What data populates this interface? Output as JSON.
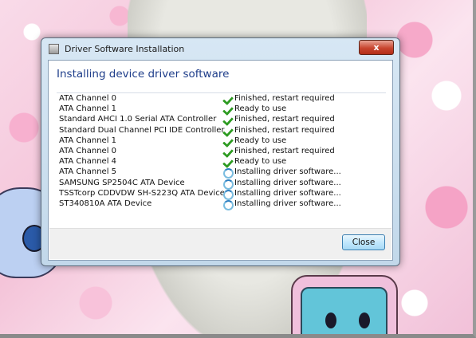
{
  "window": {
    "title": "Driver Software Installation",
    "close_glyph": "x",
    "heading": "Installing device driver software"
  },
  "devices": [
    {
      "name": "ATA Channel 0",
      "status": "Finished, restart required",
      "icon": "check-icon"
    },
    {
      "name": "ATA Channel 1",
      "status": "Ready to use",
      "icon": "check-icon"
    },
    {
      "name": "Standard AHCI 1.0 Serial ATA Controller",
      "status": "Finished, restart required",
      "icon": "check-icon"
    },
    {
      "name": "Standard Dual Channel PCI IDE Controller",
      "status": "Finished, restart required",
      "icon": "check-icon"
    },
    {
      "name": "ATA Channel 1",
      "status": "Ready to use",
      "icon": "check-icon"
    },
    {
      "name": "ATA Channel 0",
      "status": "Finished, restart required",
      "icon": "check-icon"
    },
    {
      "name": "ATA Channel 4",
      "status": "Ready to use",
      "icon": "check-icon"
    },
    {
      "name": "ATA Channel 5",
      "status": "Installing driver software...",
      "icon": "spinner-icon"
    },
    {
      "name": "SAMSUNG SP2504C ATA Device",
      "status": "Installing driver software...",
      "icon": "spinner-icon"
    },
    {
      "name": "TSSTcorp CDDVDW SH-S223Q ATA Device",
      "status": "Installing driver software...",
      "icon": "spinner-icon"
    },
    {
      "name": "ST340810A ATA Device",
      "status": "Installing driver software...",
      "icon": "spinner-icon"
    }
  ],
  "footer": {
    "close_label": "Close"
  },
  "colors": {
    "heading": "#1e3d8a",
    "check": "#2e9b22",
    "spinner": "#2d7fc0"
  }
}
